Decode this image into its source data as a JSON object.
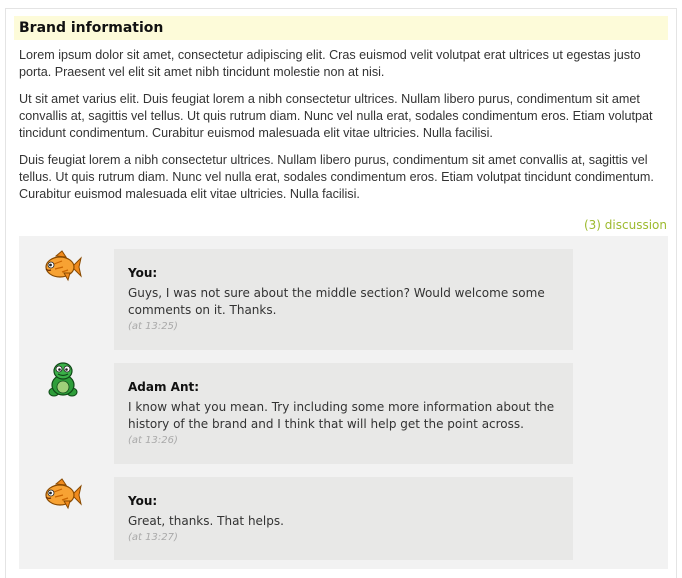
{
  "section": {
    "title": "Brand information",
    "paragraphs": [
      "Lorem ipsum dolor sit amet, consectetur adipiscing elit. Cras euismod velit volutpat erat ultrices ut egestas justo porta. Praesent vel elit sit amet nibh tincidunt molestie non at nisi.",
      "Ut sit amet varius elit. Duis feugiat lorem a nibh consectetur ultrices. Nullam libero purus, condimentum sit amet convallis at, sagittis vel tellus. Ut quis rutrum diam. Nunc vel nulla erat, sodales condimentum eros. Etiam volutpat tincidunt condimentum. Curabitur euismod malesuada elit vitae ultricies. Nulla facilisi.",
      "Duis feugiat lorem a nibh consectetur ultrices. Nullam libero purus, condimentum sit amet convallis at, sagittis vel tellus. Ut quis rutrum diam. Nunc vel nulla erat, sodales condimentum eros. Etiam volutpat tincidunt condimentum. Curabitur euismod malesuada elit vitae ultricies. Nulla facilisi."
    ]
  },
  "discussion": {
    "link_label": "(3) discussion",
    "comments": [
      {
        "author": "You:",
        "avatar": "fish-icon",
        "text": "Guys, I was not sure about the middle section? Would welcome some comments on it. Thanks.",
        "time": "(at 13:25)"
      },
      {
        "author": "Adam Ant:",
        "avatar": "turtle-icon",
        "text": "I know what you mean. Try including some more information about the history of the brand and I think that will help get the point across.",
        "time": "(at 13:26)"
      },
      {
        "author": "You:",
        "avatar": "fish-icon",
        "text": "Great, thanks. That helps.",
        "time": "(at 13:27)"
      }
    ]
  },
  "colors": {
    "title_highlight": "#fdfbd9",
    "link": "#9dba2e",
    "panel": "#f2f2f2",
    "bubble": "#e8e8e7"
  }
}
